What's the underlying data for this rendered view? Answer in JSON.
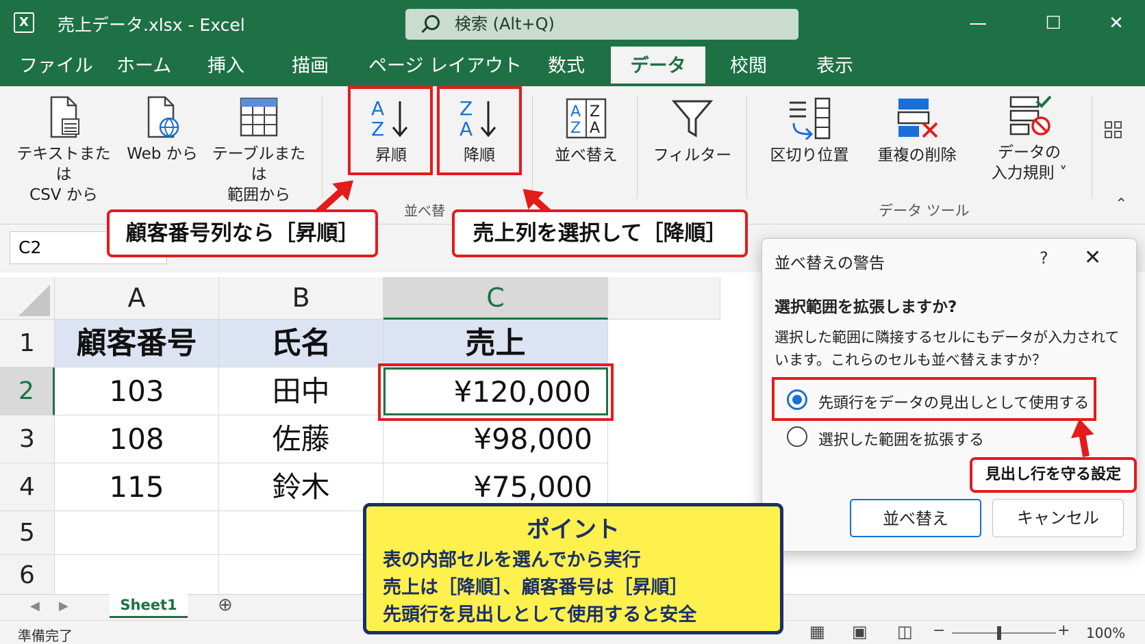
{
  "window": {
    "app_icon": "X",
    "title": "売上データ.xlsx  -  Excel",
    "search": "検索 (Alt+Q)",
    "minimize": "—",
    "maximize": "☐",
    "close": "✕"
  },
  "tabs": [
    "ファイル",
    "ホーム",
    "挿入",
    "描画",
    "ページ レイアウト",
    "数式",
    "データ",
    "校閲",
    "表示"
  ],
  "active_tab": "データ",
  "ribbon": {
    "text_csv": "テキストまたは\nCSV から",
    "web": "Web から",
    "table_range": "テーブルまたは\n範囲から",
    "sort_asc": "昇順",
    "sort_desc": "降順",
    "sort": "並べ替え",
    "filter": "フィルター",
    "text_to_columns": "区切り位置",
    "remove_dup": "重複の削除",
    "validation": "データの\n入力規則 ˅",
    "group_sort": "並べ替えとフィルター",
    "group_tools": "データ ツール"
  },
  "callouts": {
    "asc": "顧客番号列なら［昇順］",
    "desc": "売上列を選択して［降順］",
    "header": "見出し行を守る設定"
  },
  "formula_bar": {
    "name_box": "C2"
  },
  "grid": {
    "columns": [
      "A",
      "B",
      "C"
    ],
    "rows": [
      "1",
      "2",
      "3",
      "4",
      "5",
      "6"
    ],
    "headers": [
      "顧客番号",
      "氏名",
      "売上"
    ],
    "data": [
      [
        "103",
        "田中",
        "¥120,000"
      ],
      [
        "108",
        "佐藤",
        "¥98,000"
      ],
      [
        "115",
        "鈴木",
        "¥75,000"
      ]
    ]
  },
  "sheet_tab": "Sheet1",
  "status": {
    "ready": "準備完了",
    "zoom": "100%"
  },
  "dialog": {
    "title": "並べ替えの警告",
    "help": "?",
    "close": "✕",
    "heading": "選択範囲を拡張しますか?",
    "body": "選択した範囲に隣接するセルにもデータが入力されています。これらのセルも並べ替えますか？",
    "option1": "先頭行をデータの見出しとして使用する",
    "option2": "選択した範囲を拡張する",
    "ok": "並べ替え",
    "cancel": "キャンセル"
  },
  "point": {
    "title": "ポイント",
    "lines": [
      "表の内部セルを選んでから実行",
      "売上は［降順］、顧客番号は［昇順］",
      "先頭行を見出しとして使用すると安全"
    ]
  }
}
